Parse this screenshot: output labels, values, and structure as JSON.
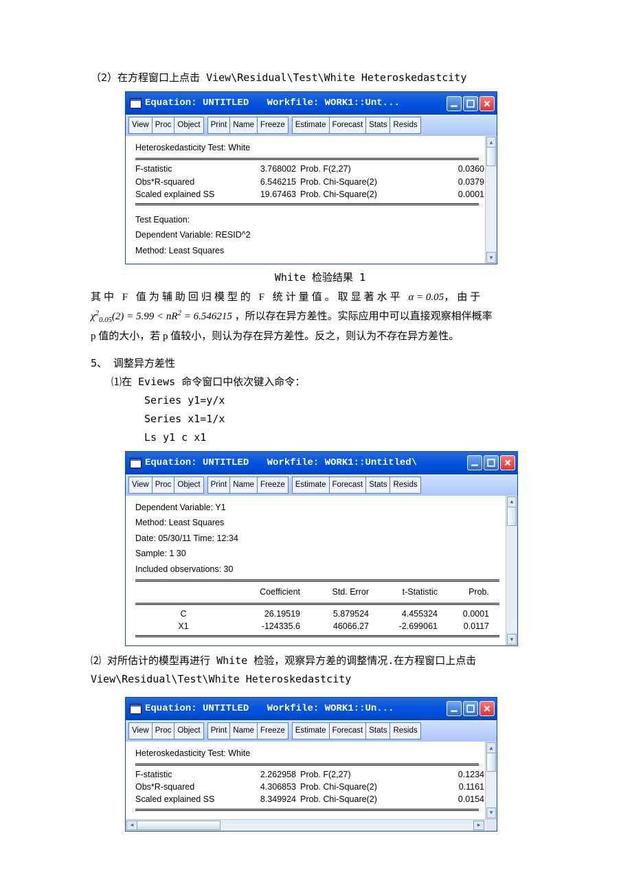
{
  "intro2": "（2）在方程窗口上点击 View\\Residual\\Test\\White Heteroskedastcity",
  "win1": {
    "title_eq": "Equation: UNTITLED",
    "title_wf": "Workfile: WORK1::Unt...",
    "toolbar": {
      "g1": [
        "View",
        "Proc",
        "Object"
      ],
      "g2": [
        "Print",
        "Name",
        "Freeze"
      ],
      "g3": [
        "Estimate",
        "Forecast",
        "Stats",
        "Resids"
      ]
    },
    "hetero_title": "Heteroskedasticity Test: White",
    "rows": [
      {
        "l": "F-statistic",
        "v": "3.768002",
        "p": "Prob. F(2,27)",
        "pv": "0.0360"
      },
      {
        "l": "Obs*R-squared",
        "v": "6.546215",
        "p": "Prob. Chi-Square(2)",
        "pv": "0.0379"
      },
      {
        "l": "Scaled explained SS",
        "v": "19.67463",
        "p": "Prob. Chi-Square(2)",
        "pv": "0.0001"
      }
    ],
    "te1": "Test Equation:",
    "te2": "Dependent Variable: RESID^2",
    "te3": "Method: Least Squares"
  },
  "caption1": "White 检验结果 1",
  "para1_a": "其中 F 值为辅助回归模型的 F 统计量值。取显著水平 ",
  "alpha_eq": "α = 0.05",
  "para1_b": "，由于",
  "chi_expr": {
    "chi": "χ",
    "sub": "0.05",
    "sup": "2",
    "arg": "(2) = 5.99 < ",
    "nr": "nR",
    "nr_sup": "2",
    "tail": " = 6.546215"
  },
  "para1_c": "，所以存在异方差性。实际应用中可以直接观察相伴概率",
  "para1_d": "p 值的大小，若 p 值较小，则认为存在异方差性。反之，则认为不存在异方差性。",
  "sec5_title": "5、 调整异方差性",
  "sec5_1": "⑴在 Eviews 命令窗口中依次键入命令：",
  "cmds": [
    "Series y1=y/x",
    "Series x1=1/x",
    "Ls y1 c x1"
  ],
  "win2": {
    "title_eq": "Equation: UNTITLED",
    "title_wf": "Workfile: WORK1::Untitled\\",
    "toolbar": {
      "g1": [
        "View",
        "Proc",
        "Object"
      ],
      "g2": [
        "Print",
        "Name",
        "Freeze"
      ],
      "g3": [
        "Estimate",
        "Forecast",
        "Stats",
        "Resids"
      ]
    },
    "meta": [
      "Dependent Variable: Y1",
      "Method: Least Squares",
      "Date: 05/30/11   Time: 12:34",
      "Sample: 1 30",
      "Included observations: 30"
    ],
    "hdr": [
      "",
      "Coefficient",
      "Std. Error",
      "t-Statistic",
      "Prob."
    ],
    "rows": [
      {
        "n": "C",
        "c": "26.19519",
        "s": "5.879524",
        "t": "4.455324",
        "p": "0.0001"
      },
      {
        "n": "X1",
        "c": "-124335.6",
        "s": "46066.27",
        "t": "-2.699061",
        "p": "0.0117"
      }
    ]
  },
  "sec5_2a": "⑵ 对所估计的模型再进行 White 检验，观察异方差的调整情况.在方程窗口上点击",
  "sec5_2b": "View\\Residual\\Test\\White Heteroskedastcity",
  "win3": {
    "title_eq": "Equation: UNTITLED",
    "title_wf": "Workfile: WORK1::Un...",
    "toolbar": {
      "g1": [
        "View",
        "Proc",
        "Object"
      ],
      "g2": [
        "Print",
        "Name",
        "Freeze"
      ],
      "g3": [
        "Estimate",
        "Forecast",
        "Stats",
        "Resids"
      ]
    },
    "hetero_title": "Heteroskedasticity Test: White",
    "rows": [
      {
        "l": "F-statistic",
        "v": "2.262958",
        "p": "Prob. F(2,27)",
        "pv": "0.1234"
      },
      {
        "l": "Obs*R-squared",
        "v": "4.306853",
        "p": "Prob. Chi-Square(2)",
        "pv": "0.1161"
      },
      {
        "l": "Scaled explained SS",
        "v": "8.349924",
        "p": "Prob. Chi-Square(2)",
        "pv": "0.0154"
      }
    ]
  }
}
